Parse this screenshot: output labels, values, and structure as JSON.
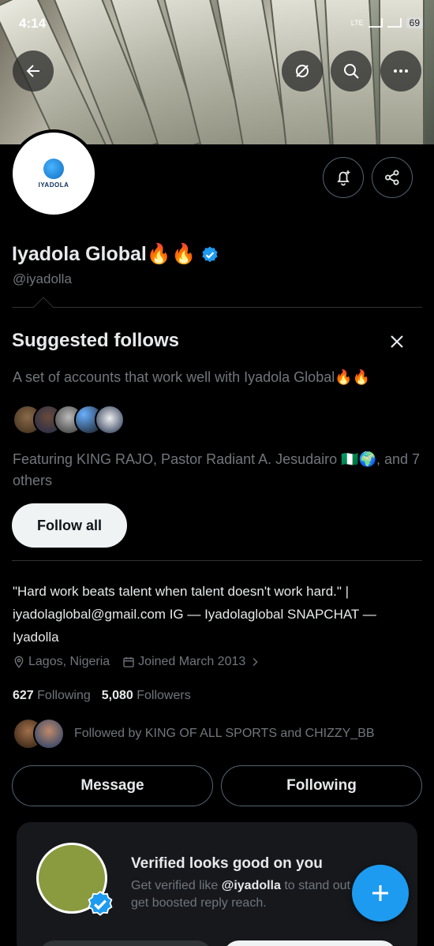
{
  "status_bar": {
    "time": "4:14",
    "network": "LTE",
    "battery": "69"
  },
  "header": {
    "back_icon": "arrow-left-icon",
    "grok_icon": "grok-icon",
    "search_icon": "search-icon",
    "more_icon": "more-horizontal-icon"
  },
  "profile": {
    "avatar_text": "IYADOLA",
    "name": "Iyadola Global🔥🔥",
    "handle": "@iyadolla",
    "bio": "\"Hard work beats talent when talent doesn't work hard.\" | iyadolaglobal@gmail.com IG — Iyadolaglobal   SNAPCHAT — Iyadolla",
    "location": "Lagos, Nigeria",
    "joined": "Joined March 2013",
    "following_count": "627",
    "following_label": "Following",
    "followers_count": "5,080",
    "followers_label": "Followers",
    "followed_by": "Followed by KING OF ALL SPORTS and CHIZZY_BB",
    "message_label": "Message",
    "following_button_label": "Following"
  },
  "suggested": {
    "title": "Suggested follows",
    "subtitle": "A set of accounts that work well with Iyadola Global🔥🔥",
    "featuring": "Featuring KING RAJO, Pastor Radiant A. Jesudairo 🇳🇬🌍, and 7 others",
    "follow_all_label": "Follow all"
  },
  "promo": {
    "title": "Verified looks good on you",
    "text_prefix": "Get verified like ",
    "text_handle": "@iyadolla",
    "text_suffix": " to stand out",
    "text_line2": "get boosted reply reach."
  },
  "colors": {
    "accent": "#1d9bf0",
    "background": "#000000",
    "muted": "#71767b",
    "text": "#e7e9ea"
  }
}
